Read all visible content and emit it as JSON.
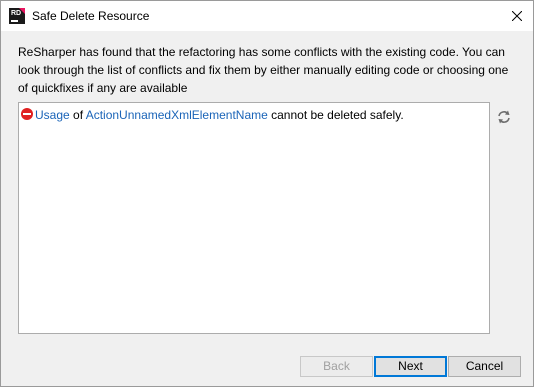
{
  "window": {
    "title": "Safe Delete Resource",
    "app_icon_text": "RD"
  },
  "message": "ReSharper has found that the refactoring has some conflicts with the existing code. You can look through the list of conflicts and fix them by either manually editing code or choosing one of quickfixes if any are available",
  "conflicts": [
    {
      "icon": "error-icon",
      "usage_link": "Usage",
      "connector": " of ",
      "element_link": "ActionUnnamedXmlElementName",
      "suffix": " cannot be deleted safely."
    }
  ],
  "buttons": {
    "back": "Back",
    "next": "Next",
    "cancel": "Cancel"
  },
  "colors": {
    "link": "#1a64b8",
    "error": "#e02020",
    "focus_border": "#0078d7"
  }
}
